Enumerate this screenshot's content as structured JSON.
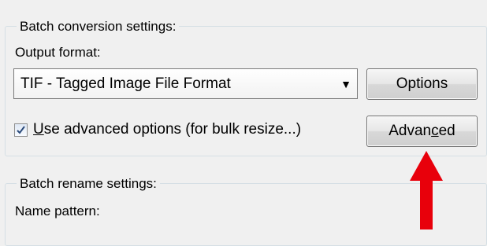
{
  "batch_conversion": {
    "title": "Batch conversion settings:",
    "output_format_label": "Output format:",
    "selected_format": "TIF - Tagged Image File Format",
    "options_button": "Options",
    "advanced_checkbox": {
      "checked": true,
      "label_underlined": "U",
      "label_rest": "se advanced options (for bulk resize...)"
    },
    "advanced_button": {
      "before": "Advan",
      "underlined": "c",
      "after": "ed"
    }
  },
  "batch_rename": {
    "title": "Batch rename settings:",
    "name_pattern_label": "Name pattern:"
  },
  "annotation": {
    "arrow_color": "#e8000b",
    "icon": "red-up-arrow-icon"
  }
}
